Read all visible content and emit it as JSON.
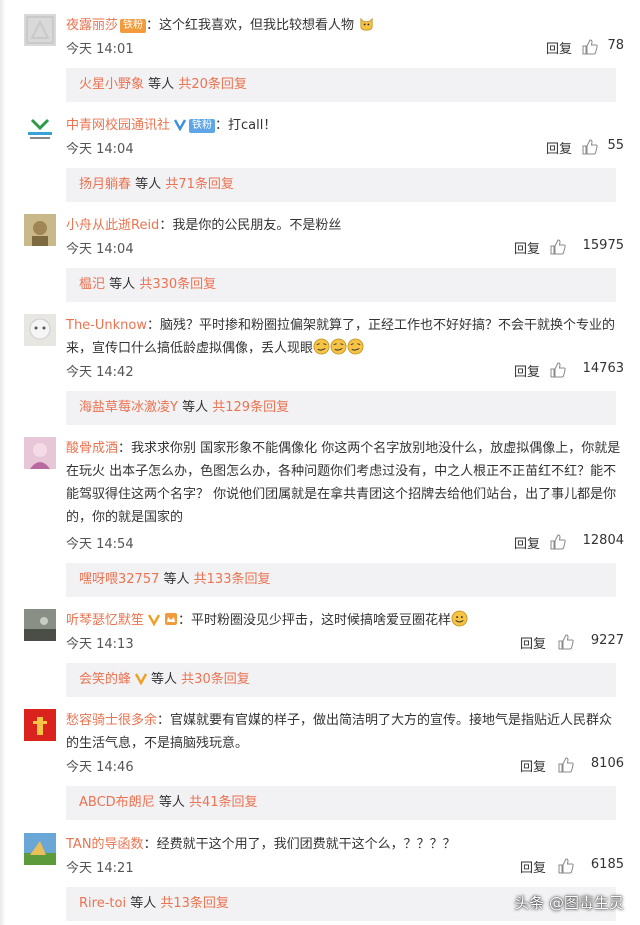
{
  "colors": {
    "username": "#eb7350",
    "badge_orange": "#f29b3c",
    "badge_blue": "#5ea6e7",
    "reply_bg": "#f2f2f5"
  },
  "comments": [
    {
      "username": "夜露丽莎",
      "badge": "铁粉",
      "text": "：这个红我喜欢，但我比较想看人物",
      "time": "今天 14:01",
      "reply_label": "回复",
      "likes": "78",
      "sub": {
        "first": "火星小野象",
        "suffix": "等人",
        "total": "共20条回复"
      }
    },
    {
      "username": "中青网校园通讯社",
      "badge": "铁粉",
      "text": "：打call！",
      "time": "今天 14:04",
      "reply_label": "回复",
      "likes": "55",
      "sub": {
        "first": "扬月躺春",
        "suffix": "等人",
        "total": "共71条回复"
      }
    },
    {
      "username": "小舟从此逝Reid",
      "text": "：我是你的公民朋友。不是粉丝",
      "time": "今天 14:04",
      "reply_label": "回复",
      "likes": "15975",
      "sub": {
        "first": "榅汜",
        "suffix": "等人",
        "total": "共330条回复"
      }
    },
    {
      "username": "The-Unknow",
      "text": "：脑残？平时掺和粉圈拉偏架就算了，正经工作也不好好搞？不会干就换个专业的来，宣传口什么搞低龄虚拟偶像，丢人现眼",
      "time": "今天 14:42",
      "reply_label": "回复",
      "likes": "14763",
      "sub": {
        "first": "海盐草莓冰激凌Y",
        "suffix": "等人",
        "total": "共129条回复"
      }
    },
    {
      "username": "酸骨成酒",
      "text": "：我求求你别 国家形象不能偶像化 你这两个名字放别地没什么，放虚拟偶像上，你就是在玩火 出本子怎么办，色图怎么办，各种问题你们考虑过没有，中之人根正不正苗红不红？能不能驾驭得住这两个名字？ 你说他们团属就是在拿共青团这个招牌去给他们站台，出了事儿都是你的，你的就是国家的",
      "time": "今天 14:54",
      "reply_label": "回复",
      "likes": "12804",
      "sub": {
        "first": "嘿呀喂32757",
        "suffix": "等人",
        "total": "共133条回复"
      }
    },
    {
      "username": "听琴瑟忆默笙",
      "text": "：平时粉圈没见少抨击，这时候搞啥爱豆圈花样",
      "time": "今天 14:13",
      "reply_label": "回复",
      "likes": "9227",
      "sub": {
        "first": "会笑的蜂",
        "suffix": "等人",
        "total": "共30条回复"
      }
    },
    {
      "username": "愁容骑士很多余",
      "text": "：官媒就要有官媒的样子，做出简洁明了大方的宣传。接地气是指贴近人民群众的生活气息，不是搞脑残玩意。",
      "time": "今天 14:46",
      "reply_label": "回复",
      "likes": "8106",
      "sub": {
        "first": "ABCD布朗尼",
        "suffix": "等人",
        "total": "共41条回复"
      }
    },
    {
      "username": "TAN的导函数",
      "text": "：经费就干这个用了，我们团费就干这个么，？？？？",
      "time": "今天 14:21",
      "reply_label": "回复",
      "likes": "6185",
      "sub": {
        "first": "Rire-toi",
        "suffix": "等人",
        "total": "共13条回复"
      }
    }
  ],
  "watermark": "头条 @图毒生灵"
}
